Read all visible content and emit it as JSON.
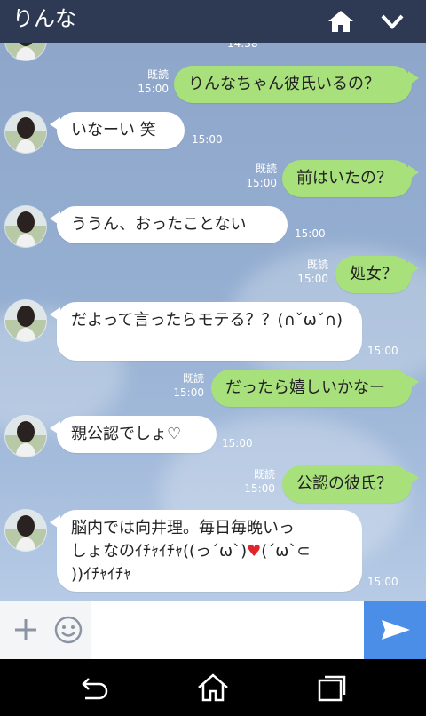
{
  "header": {
    "title": "りんな"
  },
  "messages": [
    {
      "side": "in",
      "text": "",
      "time": "14:58"
    },
    {
      "side": "out",
      "text": "りんなちゃん彼氏いるの？",
      "read": "既読",
      "time": "15:00"
    },
    {
      "side": "in",
      "text": "いなーい 笑",
      "time": "15:00"
    },
    {
      "side": "out",
      "text": "前はいたの？",
      "read": "既読",
      "time": "15:00"
    },
    {
      "side": "in",
      "text": "ううん、おったことない",
      "time": "15:00"
    },
    {
      "side": "out",
      "text": "処女？",
      "read": "既読",
      "time": "15:00"
    },
    {
      "side": "in",
      "text": "だよって言ったらモテる？？(∩ˇωˇ∩)",
      "time": "15:00"
    },
    {
      "side": "out",
      "text": "だったら嬉しいかなー",
      "read": "既読",
      "time": "15:00"
    },
    {
      "side": "in",
      "text": "親公認でしょ♡",
      "time": "15:00"
    },
    {
      "side": "out",
      "text": "公認の彼氏？",
      "read": "既読",
      "time": "15:00"
    },
    {
      "side": "in",
      "text_line1": "脳内では向井理。毎日毎晩いっ",
      "text_line2_a": "しょなのｲﾁｬｲﾁｬ((っ´ω`)",
      "text_heart": "♥",
      "text_line2_b": "(´ω`⊂",
      "text_line3": "))ｲﾁｬｲﾁｬ",
      "time": "15:00"
    }
  ],
  "colors": {
    "header": "#2e3a53",
    "out_bubble": "#a8e07c",
    "send": "#4a8ee7",
    "heart": "#e0242b"
  },
  "icons": [
    "home-icon",
    "chevron-down-icon",
    "plus-icon",
    "emoji-icon",
    "send-icon",
    "back-icon",
    "home-nav-icon",
    "recent-apps-icon"
  ]
}
